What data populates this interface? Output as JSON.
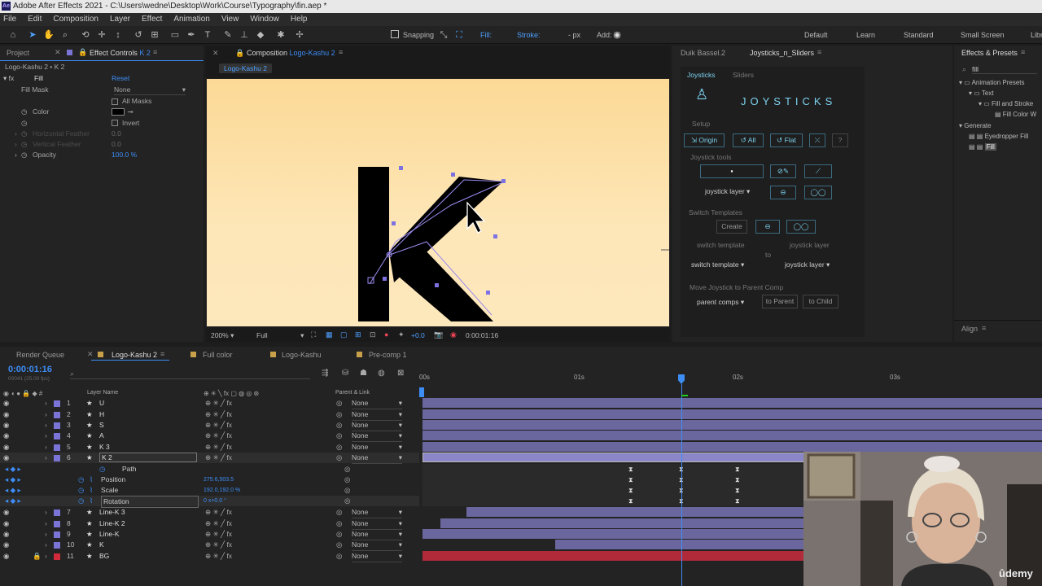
{
  "window": {
    "title": "Adobe After Effects 2021 - C:\\Users\\wedne\\Desktop\\Work\\Course\\Typography\\fin.aep *"
  },
  "menu": [
    "File",
    "Edit",
    "Composition",
    "Layer",
    "Effect",
    "Animation",
    "View",
    "Window",
    "Help"
  ],
  "toolbar": {
    "snapping": "Snapping",
    "fill": "Fill:",
    "stroke": "Stroke:",
    "stroke_q": "?",
    "px": "- px",
    "add": "Add:",
    "workspaces": [
      "Default",
      "Learn",
      "Standard",
      "Small Screen",
      "Libr"
    ]
  },
  "project_panel": {
    "tab_project": "Project",
    "tab_effect_controls": "Effect Controls",
    "tab_effect_controls_layer": "K 2",
    "subtitle": "Logo-Kashu 2 • K 2",
    "effect_name": "Fill",
    "reset": "Reset",
    "fill_mask_label": "Fill Mask",
    "fill_mask_value": "None",
    "all_masks": "All Masks",
    "color_label": "Color",
    "invert": "Invert",
    "horizontal_feather": "Horizontal Feather",
    "horizontal_feather_value": "0.0",
    "vertical_feather": "Vertical Feather",
    "vertical_feather_value": "0.0",
    "opacity_label": "Opacity",
    "opacity_value": "100.0 %"
  },
  "composition": {
    "tab_label": "Composition",
    "tab_name": "Logo-Kashu 2",
    "breadcrumb": "Logo-Kashu 2",
    "zoom": "200%",
    "resolution": "Full",
    "exposure": "+0.0",
    "timecode": "0:00:01:16",
    "letter": "K"
  },
  "joysticks_panel": {
    "tab_duik": "Duik Bassel.2",
    "tab_joysticks": "Joysticks_n_Sliders",
    "subtab_joysticks": "Joysticks",
    "subtab_sliders": "Sliders",
    "heading": "JOYSTICKS",
    "setup": "Setup",
    "origin": "Origin",
    "all": "All",
    "flat": "Flat",
    "help": "?",
    "joystick_tools": "Joystick tools",
    "joystick_layer_drop": "joystick layer",
    "switch_templates": "Switch Templates",
    "create": "Create",
    "switch_template_label": "switch template",
    "joystick_layer_label": "joystick layer",
    "to": "to",
    "switch_template_drop": "switch template",
    "joystick_layer_drop2": "joystick layer",
    "move_joystick": "Move Joystick to Parent Comp",
    "parent_comps": "parent comps",
    "to_parent": "to Parent",
    "to_child": "to Child"
  },
  "effects_presets": {
    "tab": "Effects & Presets",
    "search": "fill",
    "tree": [
      "Animation Presets",
      "Text",
      "Fill and Stroke",
      "Fill Color W",
      "Generate",
      "Eyedropper Fill",
      "Fill"
    ],
    "align": "Align"
  },
  "timeline": {
    "tabs": [
      "Render Queue",
      "Logo-Kashu 2",
      "Full color",
      "Logo-Kashu",
      "Pre-comp 1"
    ],
    "timecode": "0:00:01:16",
    "frames": "00041 (25.00 fps)",
    "col_layer_name": "Layer Name",
    "col_parent": "Parent & Link",
    "ruler": [
      "00s",
      "01s",
      "02s",
      "03s"
    ],
    "layers": [
      {
        "num": "1",
        "name": "U",
        "parent": "None",
        "color": "#7a74d6"
      },
      {
        "num": "2",
        "name": "H",
        "parent": "None",
        "color": "#7a74d6"
      },
      {
        "num": "3",
        "name": "S",
        "parent": "None",
        "color": "#7a74d6"
      },
      {
        "num": "4",
        "name": "A",
        "parent": "None",
        "color": "#7a74d6"
      },
      {
        "num": "5",
        "name": "K 3",
        "parent": "None",
        "color": "#7a74d6"
      },
      {
        "num": "6",
        "name": "K 2",
        "parent": "None",
        "color": "#7a74d6"
      }
    ],
    "props": {
      "path": "Path",
      "position": "Position",
      "position_value": "275.6,503.5",
      "scale": "Scale",
      "scale_value": "192.0,192.0 %",
      "rotation": "Rotation",
      "rotation_value": "0 x+0.0 °"
    },
    "layers2": [
      {
        "num": "7",
        "name": "Line-K 3",
        "parent": "None",
        "color": "#7a74d6"
      },
      {
        "num": "8",
        "name": "Line-K 2",
        "parent": "None",
        "color": "#7a74d6"
      },
      {
        "num": "9",
        "name": "Line-K",
        "parent": "None",
        "color": "#7a74d6"
      },
      {
        "num": "10",
        "name": "K",
        "parent": "None",
        "color": "#7a74d6"
      },
      {
        "num": "11",
        "name": "BG",
        "parent": "None",
        "color": "#d12a3a"
      }
    ]
  },
  "watermark": "ûdemy"
}
